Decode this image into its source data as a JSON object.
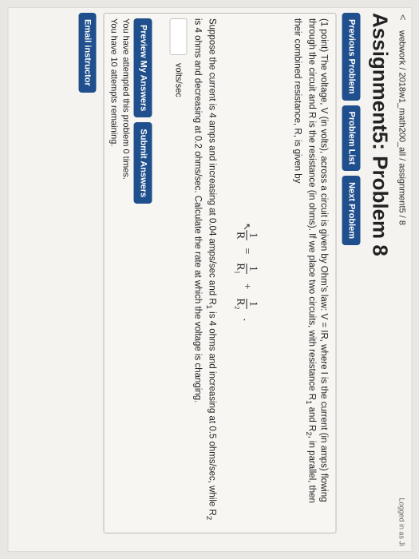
{
  "header": {
    "back_glyph": "<",
    "breadcrumb": "webwork / 2018w1_math200_all / assignment5 / 8",
    "logged_in": "Logged in as Ji"
  },
  "page_title": "Assignment5: Problem 8",
  "nav": {
    "previous": "Previous Problem",
    "list": "Problem List",
    "next": "Next Problem"
  },
  "problem": {
    "intro_a": "(1 point) The voltage, V (in volts), across a circuit is given by Ohm's law: V = IR, where I is the current (in amps) flowing through the circuit and R is the resistance (in ohms). If we place two circuits, with resistance R",
    "intro_sub1": "1",
    "intro_b": " and R",
    "intro_sub2": "2",
    "intro_c": ", in parallel, then their combined resistance, R, is given by",
    "formula": {
      "one": "1",
      "R": "R",
      "eq": "=",
      "R1": "R₁",
      "plus": "+",
      "R2": "R₂",
      "period": "."
    },
    "question_a": "Suppose the current is 4 amps and increasing at 0.04 amps/sec and R",
    "question_sub1": "1",
    "question_b": " is 4 ohms and increasing at 0.5 ohms/sec, while R",
    "question_sub2": "2",
    "question_c": " is 4 ohms and decreasing at 0.2 ohms/sec. Calculate the rate at which the voltage is changing.",
    "answer_value": "",
    "units": "volts/sec"
  },
  "actions": {
    "preview": "Preview My Answers",
    "submit": "Submit Answers"
  },
  "attempts": {
    "line1": "You have attempted this problem 0 times.",
    "line2": "You have 10 attempts remaining."
  },
  "footer": {
    "email": "Email instructor"
  },
  "colors": {
    "button": "#1f4f8c",
    "page_bg": "#f4f3f0"
  }
}
